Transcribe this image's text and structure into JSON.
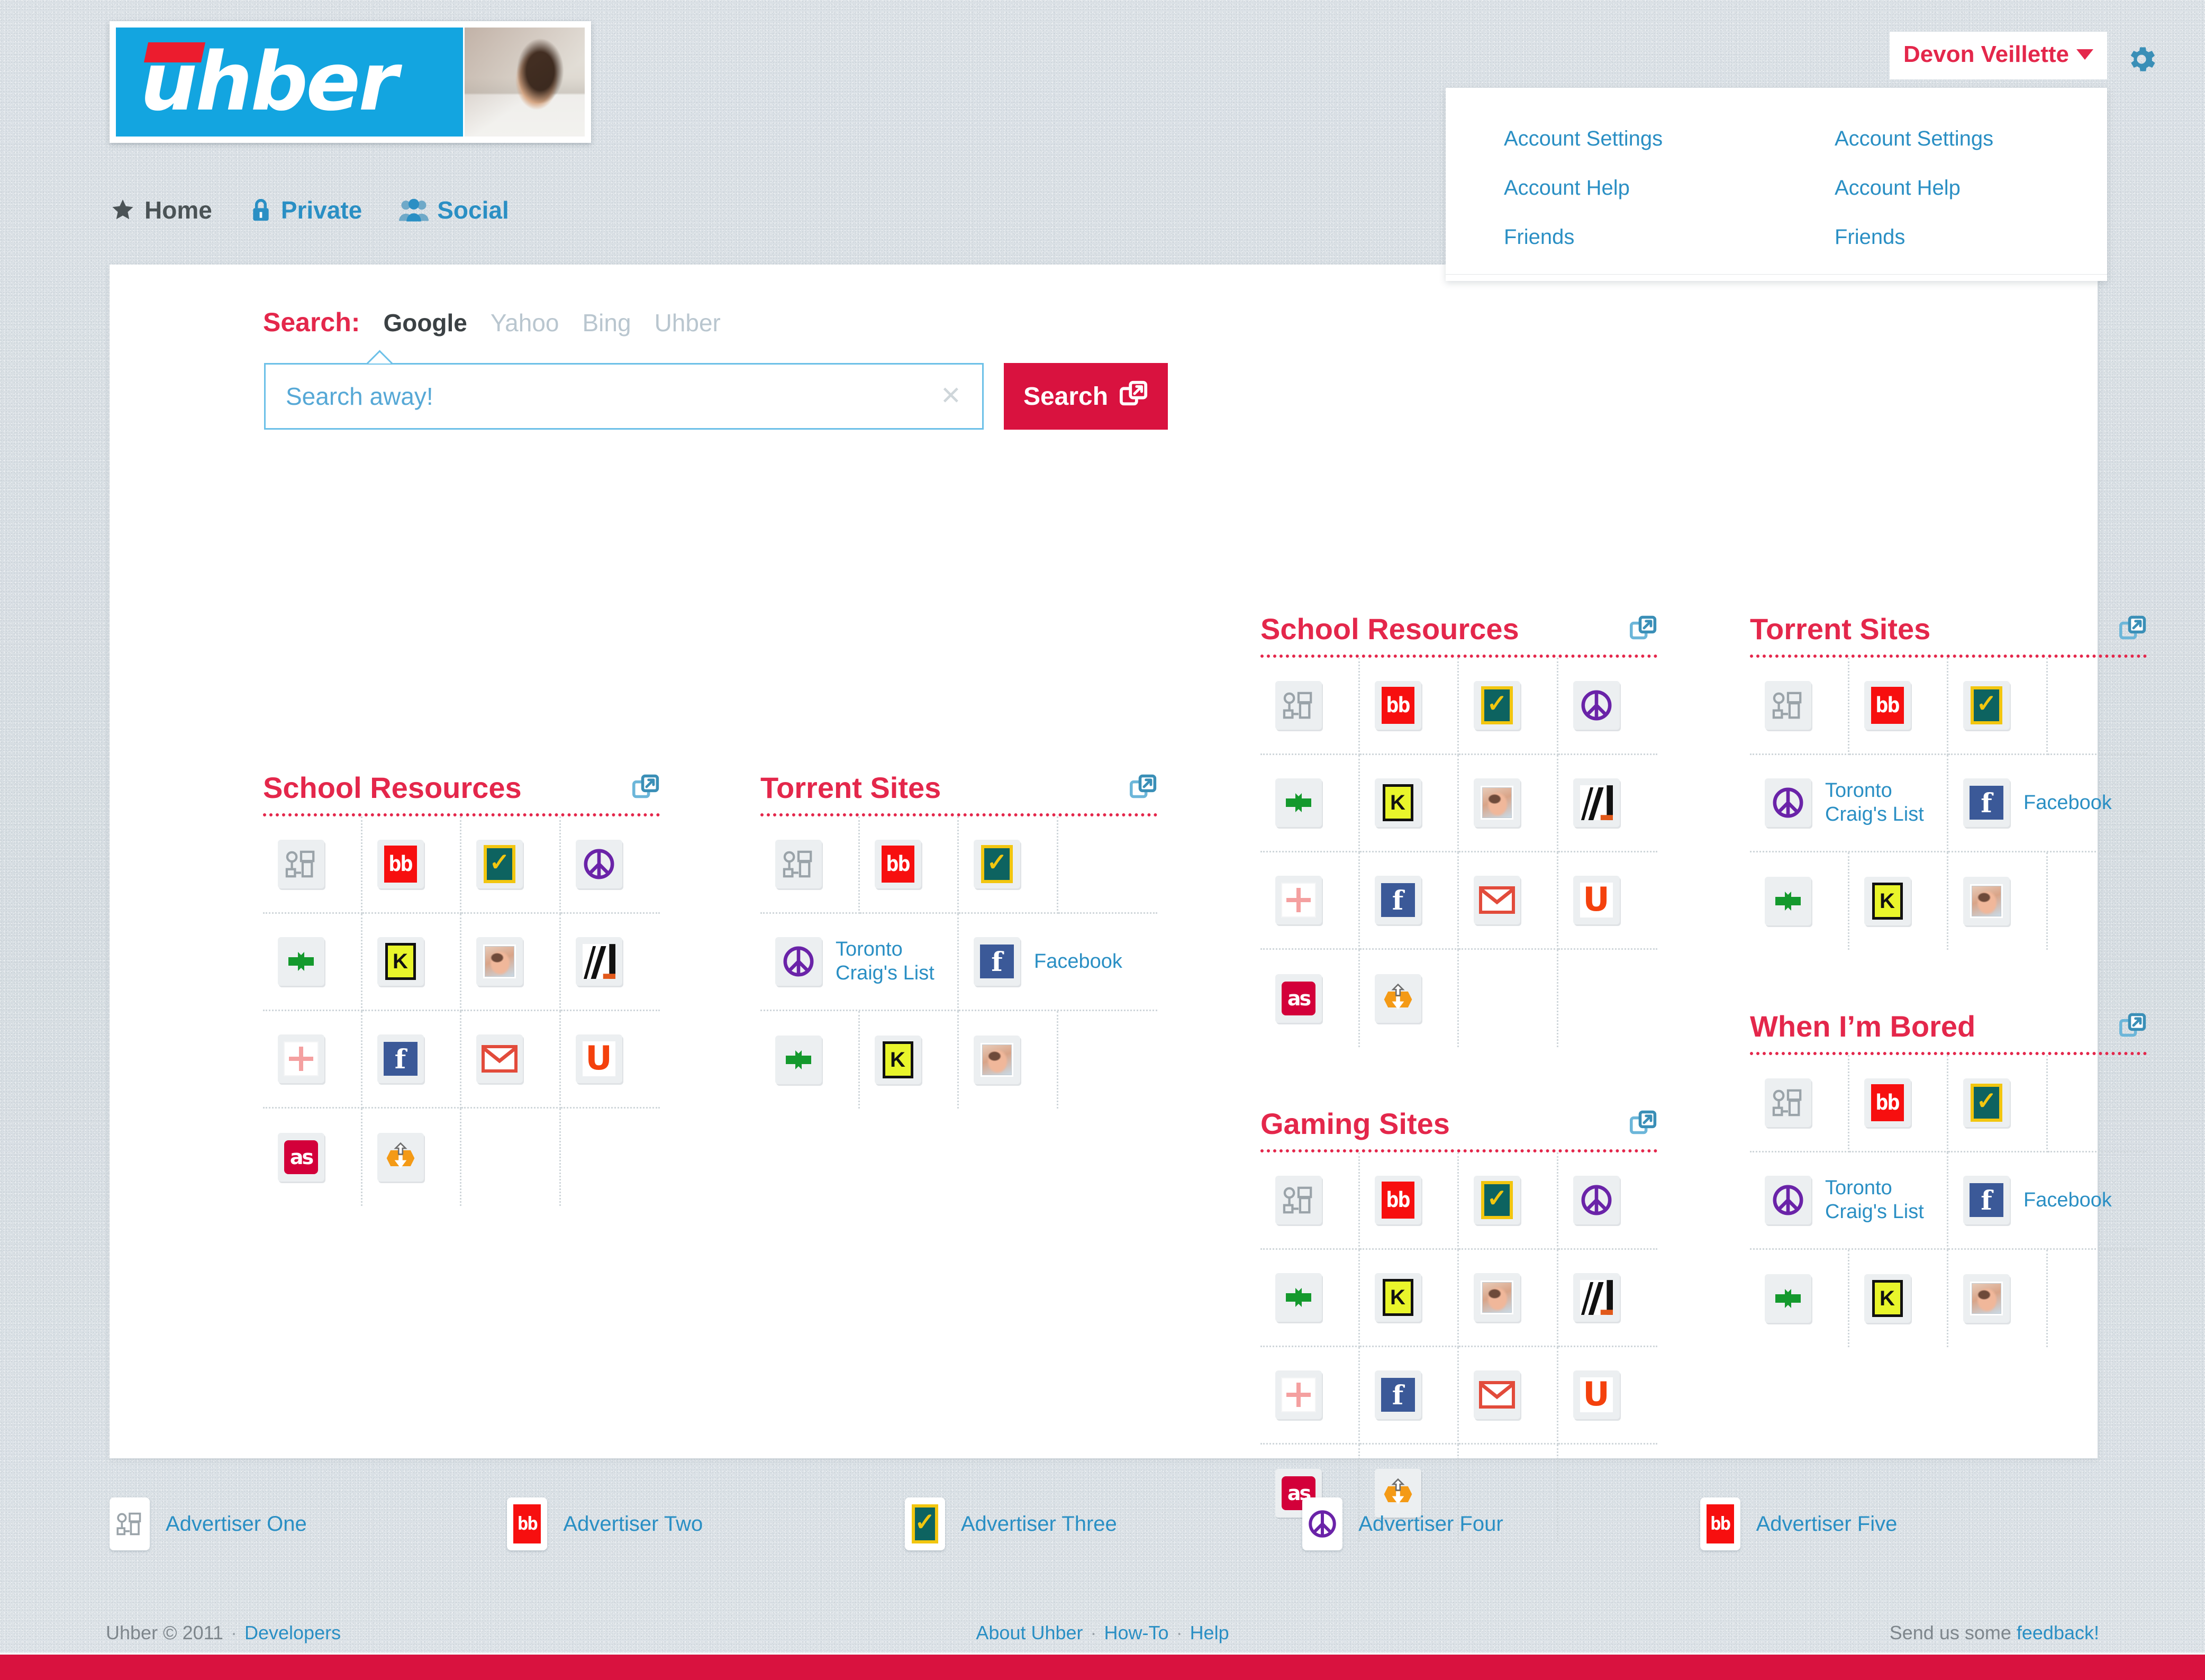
{
  "brand": {
    "logo_word": "uhber",
    "accent_red": "#e4274b",
    "accent_blue": "#2a8fc4",
    "logo_blue": "#13a5e0",
    "button_red": "#d9123f"
  },
  "nav": {
    "items": [
      {
        "label": "Home",
        "icon": "star-icon",
        "active": true
      },
      {
        "label": "Private",
        "icon": "lock-icon",
        "active": false
      },
      {
        "label": "Social",
        "icon": "people-icon",
        "active": false
      }
    ]
  },
  "user": {
    "name": "Devon Veillette",
    "caret": "▾",
    "gear_icon": "gear-icon",
    "menu_columns": [
      {
        "items": [
          "Account Settings",
          "Account Help",
          "Friends"
        ]
      },
      {
        "items": [
          "Account Settings",
          "Account Help",
          "Friends"
        ]
      }
    ]
  },
  "search": {
    "label": "Search:",
    "engines": [
      {
        "name": "Google",
        "active": true
      },
      {
        "name": "Yahoo",
        "active": false
      },
      {
        "name": "Bing",
        "active": false
      },
      {
        "name": "Uhber",
        "active": false
      }
    ],
    "placeholder": "Search away!",
    "value": "",
    "clear_icon": "close-icon",
    "button_label": "Search",
    "button_icon": "external-link-icon"
  },
  "widgets": {
    "open_icon": "external-link-icon",
    "col_a": [
      {
        "title": "School Resources",
        "layout": "grid4",
        "tiles": [
          {
            "icon": "people-printer-icon"
          },
          {
            "icon": "bb-icon"
          },
          {
            "icon": "checkmark-icon"
          },
          {
            "icon": "peace-icon"
          },
          {
            "icon": "recycle-arrows-icon"
          },
          {
            "icon": "kijiji-k-icon"
          },
          {
            "icon": "portrait-icon"
          },
          {
            "icon": "slash-icon"
          },
          {
            "icon": "plus-icon"
          },
          {
            "icon": "facebook-icon"
          },
          {
            "icon": "gmail-icon"
          },
          {
            "icon": "u-icon"
          },
          {
            "icon": "lastfm-icon"
          },
          {
            "icon": "download-icon"
          }
        ]
      }
    ],
    "col_b": [
      {
        "title": "Torrent Sites",
        "layout": "mixed",
        "row1": [
          {
            "icon": "people-printer-icon"
          },
          {
            "icon": "bb-icon"
          },
          {
            "icon": "checkmark-icon"
          }
        ],
        "row2": [
          {
            "icon": "peace-icon",
            "label": "Toronto\nCraig's List"
          },
          {
            "icon": "facebook-icon",
            "label": "Facebook"
          }
        ],
        "row3": [
          {
            "icon": "recycle-arrows-icon"
          },
          {
            "icon": "kijiji-k-icon"
          },
          {
            "icon": "portrait-icon"
          }
        ]
      }
    ],
    "col_c": [
      {
        "title": "School Resources",
        "layout": "grid4",
        "tiles": [
          {
            "icon": "people-printer-icon"
          },
          {
            "icon": "bb-icon"
          },
          {
            "icon": "checkmark-icon"
          },
          {
            "icon": "peace-icon"
          },
          {
            "icon": "recycle-arrows-icon"
          },
          {
            "icon": "kijiji-k-icon"
          },
          {
            "icon": "portrait-icon"
          },
          {
            "icon": "slash-icon"
          },
          {
            "icon": "plus-icon"
          },
          {
            "icon": "facebook-icon"
          },
          {
            "icon": "gmail-icon"
          },
          {
            "icon": "u-icon"
          },
          {
            "icon": "lastfm-icon"
          },
          {
            "icon": "download-icon"
          }
        ]
      },
      {
        "title": "Gaming Sites",
        "layout": "grid4",
        "tiles": [
          {
            "icon": "people-printer-icon"
          },
          {
            "icon": "bb-icon"
          },
          {
            "icon": "checkmark-icon"
          },
          {
            "icon": "peace-icon"
          },
          {
            "icon": "recycle-arrows-icon"
          },
          {
            "icon": "kijiji-k-icon"
          },
          {
            "icon": "portrait-icon"
          },
          {
            "icon": "slash-icon"
          },
          {
            "icon": "plus-icon"
          },
          {
            "icon": "facebook-icon"
          },
          {
            "icon": "gmail-icon"
          },
          {
            "icon": "u-icon"
          },
          {
            "icon": "lastfm-icon"
          },
          {
            "icon": "download-icon"
          }
        ]
      }
    ],
    "col_d": [
      {
        "title": "Torrent Sites",
        "layout": "mixed",
        "row1": [
          {
            "icon": "people-printer-icon"
          },
          {
            "icon": "bb-icon"
          },
          {
            "icon": "checkmark-icon"
          }
        ],
        "row2": [
          {
            "icon": "peace-icon",
            "label": "Toronto\nCraig's List"
          },
          {
            "icon": "facebook-icon",
            "label": "Facebook"
          }
        ],
        "row3": [
          {
            "icon": "recycle-arrows-icon"
          },
          {
            "icon": "kijiji-k-icon"
          },
          {
            "icon": "portrait-icon"
          }
        ]
      },
      {
        "title": "When I’m Bored",
        "layout": "mixed",
        "row1": [
          {
            "icon": "people-printer-icon"
          },
          {
            "icon": "bb-icon"
          },
          {
            "icon": "checkmark-icon"
          }
        ],
        "row2": [
          {
            "icon": "peace-icon",
            "label": "Toronto\nCraig's List"
          },
          {
            "icon": "facebook-icon",
            "label": "Facebook"
          }
        ],
        "row3": [
          {
            "icon": "recycle-arrows-icon"
          },
          {
            "icon": "kijiji-k-icon"
          },
          {
            "icon": "portrait-icon"
          }
        ]
      }
    ]
  },
  "advertisers": [
    {
      "label": "Advertiser One",
      "icon": "people-printer-icon"
    },
    {
      "label": "Advertiser Two",
      "icon": "bb-icon"
    },
    {
      "label": "Advertiser Three",
      "icon": "checkmark-icon"
    },
    {
      "label": "Advertiser Four",
      "icon": "peace-icon"
    },
    {
      "label": "Advertiser Five",
      "icon": "bb-icon"
    }
  ],
  "footer": {
    "copyright": "Uhber © 2011",
    "dot": "·",
    "developers": "Developers",
    "center_links": [
      "About Uhber",
      "How-To",
      "Help"
    ],
    "feedback_prefix": "Send us some ",
    "feedback_link": "feedback!"
  }
}
